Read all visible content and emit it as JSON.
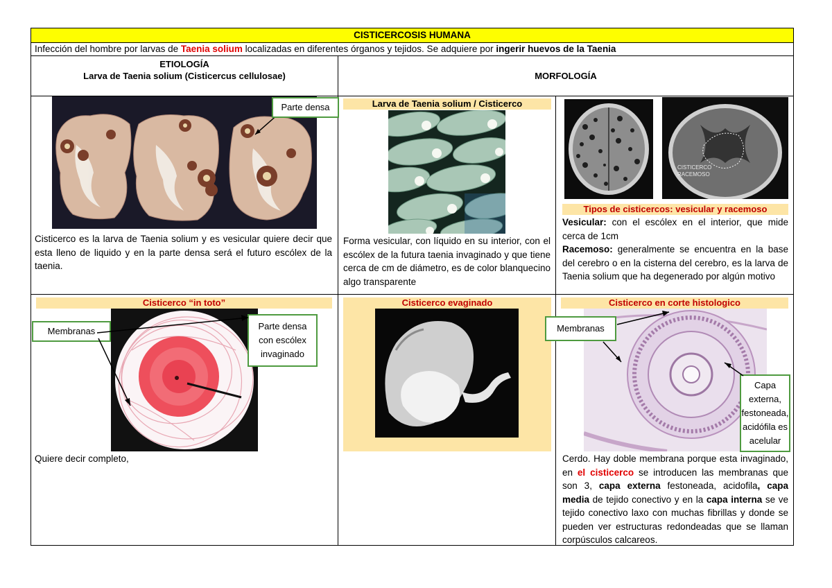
{
  "title": "CISTICERCOSIS HUMANA",
  "intro": {
    "part1": "Infección del hombre por larvas de ",
    "species": "Taenia solium",
    "part2": " localizadas en diferentes órganos y tejidos. Se adquiere por ",
    "bold_end": "ingerir huevos de la Taenia"
  },
  "header": {
    "etiologia": "ETIOLOGÍA",
    "etiologia_sub": "Larva de Taenia solium (Cisticercus cellulosae)",
    "morfologia": "MORFOLOGÍA"
  },
  "row1": {
    "col1": {
      "callout": "Parte densa",
      "text": "Cisticerco es la larva de Taenia solium y es vesicular quiere decir que esta lleno de liquido y en la parte densa será el futuro escólex de la taenia."
    },
    "col2": {
      "label": "Larva de Taenia solium / Cisticerco",
      "text": "Forma vesicular, con líquido en su interior, con el escólex de la futura taenia invaginado y que tiene cerca de cm de diámetro, es de color blanquecino algo transparente"
    },
    "col3": {
      "ct_label_line1": "CISTICERCO",
      "ct_label_line2": "RACEMOSO",
      "label": "Tipos de cisticercos: vesicular y racemoso",
      "vesicular_title": "Vesicular:",
      "vesicular_text": " con el escólex en el interior, que mide cerca de 1cm",
      "racemoso_title": "Racemoso:",
      "racemoso_text": " generalmente se encuentra en la base del cerebro o en la cisterna del cerebro, es la larva de Taenia solium que ha degenerado por algún motivo"
    }
  },
  "row2": {
    "col1": {
      "label": "Cisticerco “in toto”",
      "callout_left": "Membranas",
      "callout_right": "Parte densa con escólex invaginado",
      "text": "Quiere decir completo,"
    },
    "col2": {
      "label": "Cisticerco evaginado"
    },
    "col3": {
      "label": "Cisticerco en corte histologico",
      "callout_left": "Membranas",
      "callout_right": "Capa externa, festoneada, acidófila es acelular",
      "text_part1": "Cerdo. Hay doble membrana porque esta invaginado, en ",
      "text_red": "el cisticerco",
      "text_part2": " se introducen las membranas que son 3, ",
      "capa_externa": "capa externa",
      "text_part3": " festoneada, acidofila",
      "comma_bold": ",",
      "capa_media": " capa media",
      "text_part4": " de tejido conectivo y en la ",
      "capa_interna": "capa interna",
      "text_part5": " se ve tejido conectivo laxo con muchas fibrillas y donde se pueden ver estructuras redondeadas que se llaman corpúsculos calcareos."
    }
  },
  "colors": {
    "title_bg": "#fefe00",
    "label_band": "#fde5a6",
    "label_red": "#c00000",
    "species_red": "#e10000",
    "callout_border": "#4e9a3f"
  }
}
